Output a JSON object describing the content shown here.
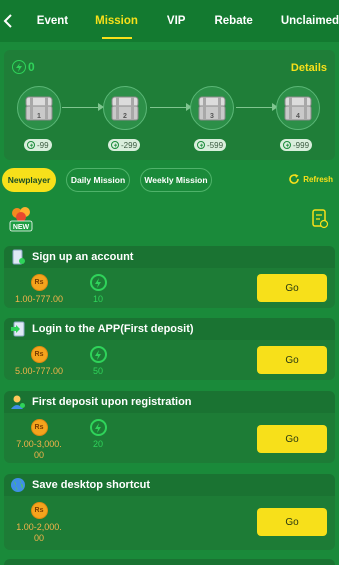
{
  "nav": {
    "tabs": [
      {
        "label": "Event"
      },
      {
        "label": "Mission"
      },
      {
        "label": "VIP"
      },
      {
        "label": "Rebate"
      },
      {
        "label": "Unclaimed"
      }
    ],
    "active_tab": "Mission"
  },
  "progress": {
    "count": "0",
    "details_label": "Details",
    "chests": [
      {
        "number": "1",
        "cost": "-99"
      },
      {
        "number": "2",
        "cost": "-299"
      },
      {
        "number": "3",
        "cost": "-599"
      },
      {
        "number": "4",
        "cost": "-999"
      }
    ]
  },
  "filters": {
    "buttons": [
      "Newplayer",
      "Daily Mission",
      "Weekly Mission"
    ],
    "active": "Newplayer",
    "refresh_label": "Refresh"
  },
  "badge": {
    "new_label": "NEW"
  },
  "tasks": [
    {
      "title": "Sign up an account",
      "cash": "1.00-777.00",
      "points": "10",
      "action": "Go"
    },
    {
      "title": "Login to the APP(First deposit)",
      "cash": "5.00-777.00",
      "points": "50",
      "action": "Go"
    },
    {
      "title": "First deposit upon registration",
      "cash_line1": "7.00-3,000.",
      "cash_line2": "00",
      "points": "20",
      "action": "Go"
    },
    {
      "title": "Save desktop shortcut",
      "cash_line1": "1.00-2,000.",
      "cash_line2": "00",
      "action": "Go"
    }
  ],
  "coin_label": "Rs",
  "colors": {
    "background": "#1a8a3a",
    "accent": "#f7e01a",
    "bolt": "#2fd35a",
    "coin": "#f4a41d"
  }
}
